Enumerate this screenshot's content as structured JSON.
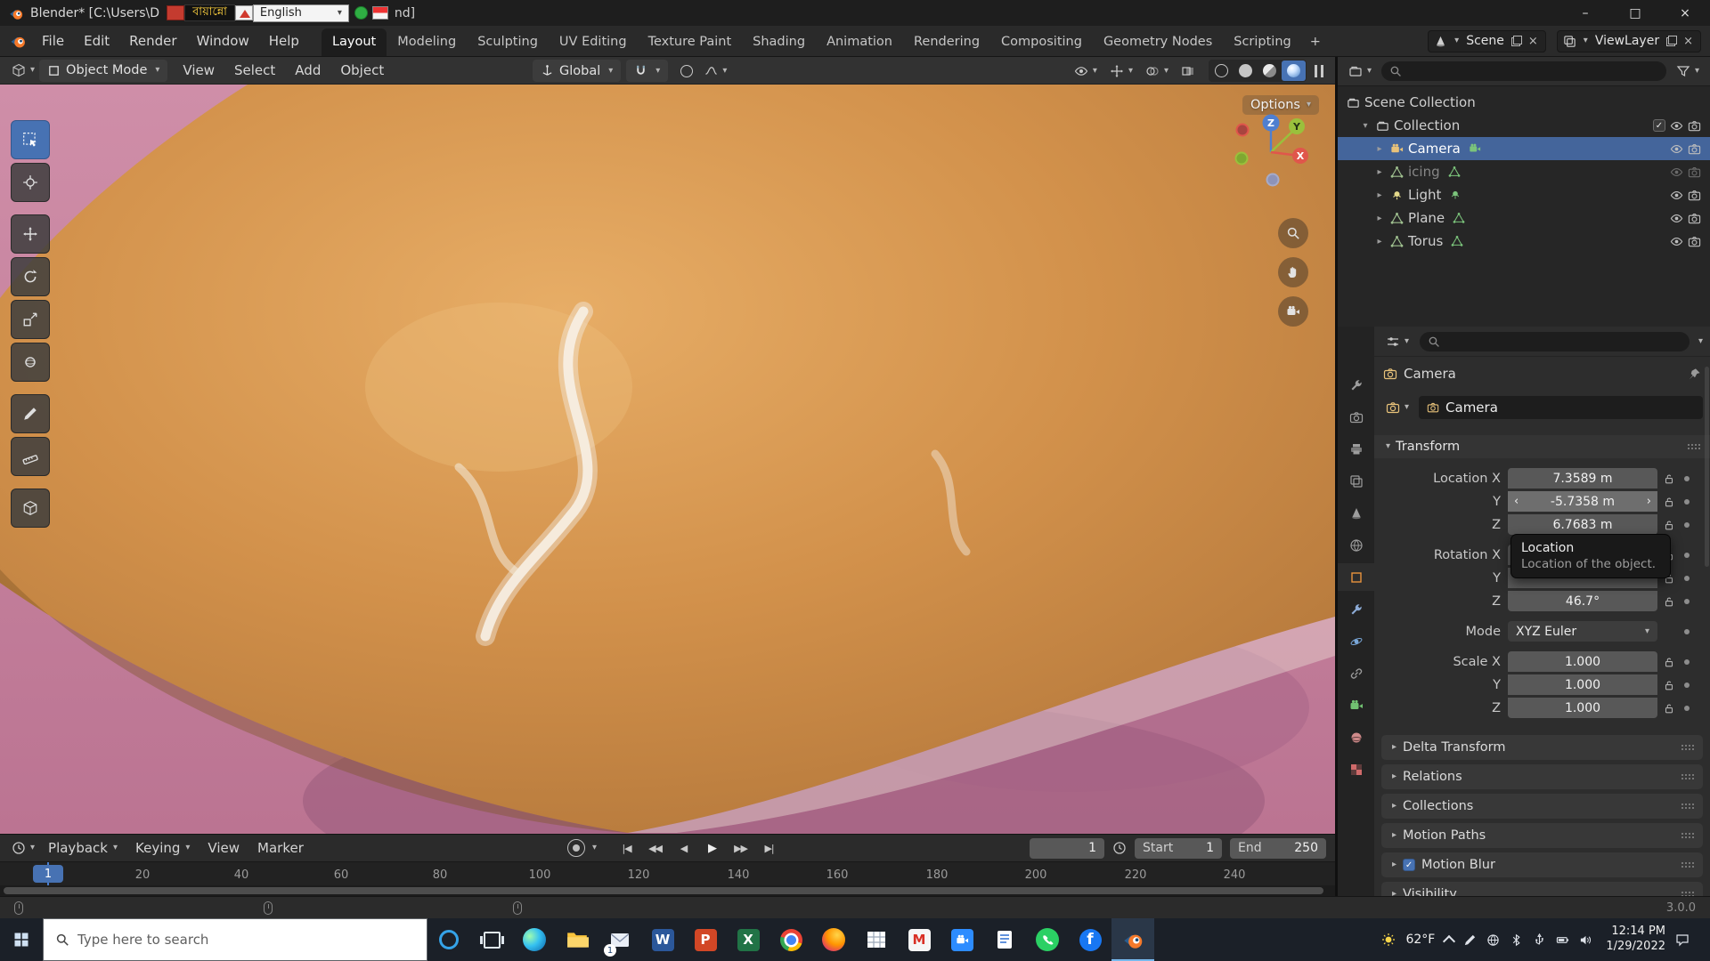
{
  "icons": {
    "chevron_down_solid": "▾",
    "chevron_right_solid": "▸",
    "chevron_left": "‹",
    "chevron_right": "›",
    "minimize": "–",
    "maximize": "□",
    "close": "×",
    "plus": "+",
    "check": "✓"
  },
  "titlebar": {
    "title": "Blender* [C:\\Users\\D",
    "title_end": "nd]",
    "lang_badge": "বায়ান্নো",
    "lang_select": "English"
  },
  "menubar": {
    "menus": [
      "File",
      "Edit",
      "Render",
      "Window",
      "Help"
    ],
    "workspaces": [
      "Layout",
      "Modeling",
      "Sculpting",
      "UV Editing",
      "Texture Paint",
      "Shading",
      "Animation",
      "Rendering",
      "Compositing",
      "Geometry Nodes",
      "Scripting"
    ],
    "scene_name": "Scene",
    "viewlayer_name": "ViewLayer"
  },
  "viewport": {
    "mode": "Object Mode",
    "menus": [
      "View",
      "Select",
      "Add",
      "Object"
    ],
    "orientation": "Global",
    "options": "Options",
    "axis": {
      "x": "X",
      "y": "Y",
      "z": "Z"
    }
  },
  "outliner": {
    "rows": [
      {
        "label": "Scene Collection"
      },
      {
        "label": "Collection"
      },
      {
        "label": "Camera"
      },
      {
        "label": "icing"
      },
      {
        "label": "Light"
      },
      {
        "label": "Plane"
      },
      {
        "label": "Torus"
      }
    ]
  },
  "properties": {
    "breadcrumb": "Camera",
    "object_name": "Camera",
    "transform_title": "Transform",
    "rows": {
      "loc_x": {
        "label": "Location X",
        "value": "7.3589 m"
      },
      "loc_y": {
        "label": "Y",
        "value": "-5.7358 m"
      },
      "loc_z": {
        "label": "Z",
        "value": "6.7683 m"
      },
      "rot_x": {
        "label": "Rotation X",
        "value": ""
      },
      "rot_y": {
        "label": "Y",
        "value": ""
      },
      "rot_z": {
        "label": "Z",
        "value": "46.7°"
      },
      "mode": {
        "label": "Mode",
        "value": "XYZ Euler"
      },
      "scale_x": {
        "label": "Scale X",
        "value": "1.000"
      },
      "scale_y": {
        "label": "Y",
        "value": "1.000"
      },
      "scale_z": {
        "label": "Z",
        "value": "1.000"
      }
    },
    "tooltip": {
      "title": "Location",
      "body": "Location of the object."
    },
    "sections": [
      "Delta Transform",
      "Relations",
      "Collections",
      "Motion Paths",
      "Motion Blur",
      "Visibility"
    ]
  },
  "timeline": {
    "menus": [
      "Playback",
      "Keying",
      "View",
      "Marker"
    ],
    "transport": [
      "|◀",
      "◀◀",
      "◀",
      "▶",
      "▶▶",
      "▶|"
    ],
    "current_frame": "1",
    "playhead": "1",
    "start_label": "Start",
    "start_value": "1",
    "end_label": "End",
    "end_value": "250",
    "ticks": [
      "20",
      "40",
      "60",
      "80",
      "100",
      "120",
      "140",
      "160",
      "180",
      "200",
      "220",
      "240"
    ]
  },
  "statusbar": {
    "version": "3.0.0"
  },
  "taskbar": {
    "search_placeholder": "Type here to search",
    "mail_badge": "1",
    "letters": {
      "word": "W",
      "powerpoint": "P",
      "excel": "X",
      "gmail": "M",
      "facebook": "f"
    },
    "weather": "62°F",
    "time": "12:14 PM",
    "date": "1/29/2022"
  }
}
